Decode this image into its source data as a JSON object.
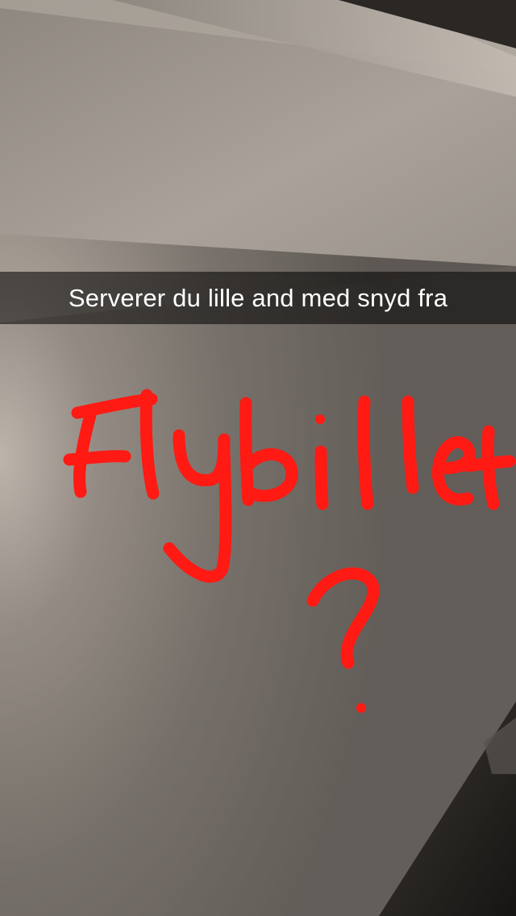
{
  "caption": {
    "text": "Serverer du lille and med snyd fra"
  },
  "drawing": {
    "handwritten_text": "Flybillet",
    "handwritten_mark": "?",
    "color": "#ff1a14"
  },
  "photo": {
    "subject": "ceiling-corner-photo"
  }
}
